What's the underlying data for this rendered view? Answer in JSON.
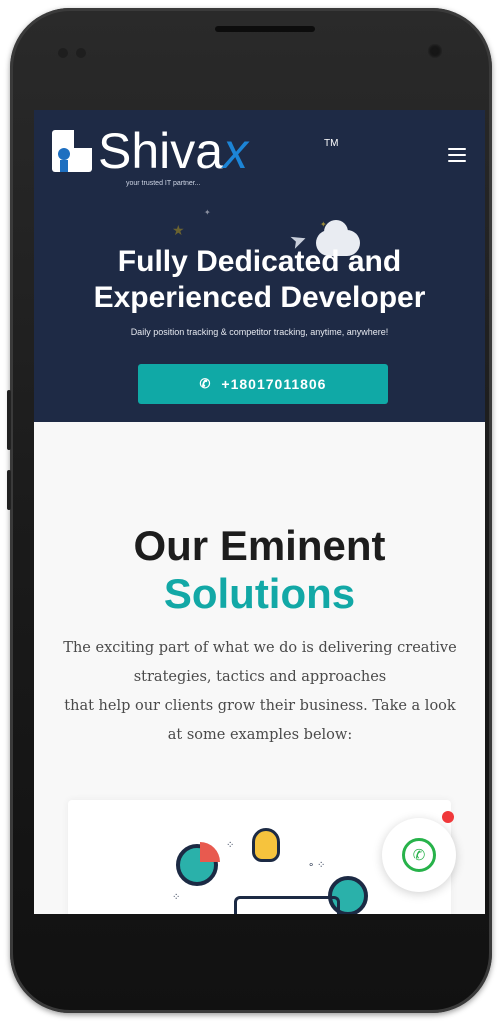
{
  "header": {
    "logo": {
      "name": "Shiva",
      "x": "x",
      "tm": "TM",
      "tagline": "your trusted IT partner..."
    },
    "menu_icon": "hamburger-menu-icon"
  },
  "hero": {
    "title_line1": "Fully Dedicated and",
    "title_line2": "Experienced Developer",
    "subtitle": "Daily position tracking & competitor tracking, anytime, anywhere!",
    "call_button": {
      "icon": "phone-icon",
      "label": "+18017011806"
    }
  },
  "solutions": {
    "title_line1": "Our Eminent",
    "title_line2": "Solutions",
    "description_line1": "The exciting part of what we do is delivering creative",
    "description_line2": "strategies, tactics and approaches",
    "description_line3": "that help our clients grow their business. Take a look",
    "description_line4": "at some examples below:"
  },
  "whatsapp": {
    "icon": "whatsapp-icon"
  },
  "colors": {
    "navy": "#1e2a45",
    "teal": "#10a9a6",
    "whatsapp": "#27b24a",
    "notify": "#f0383a"
  }
}
